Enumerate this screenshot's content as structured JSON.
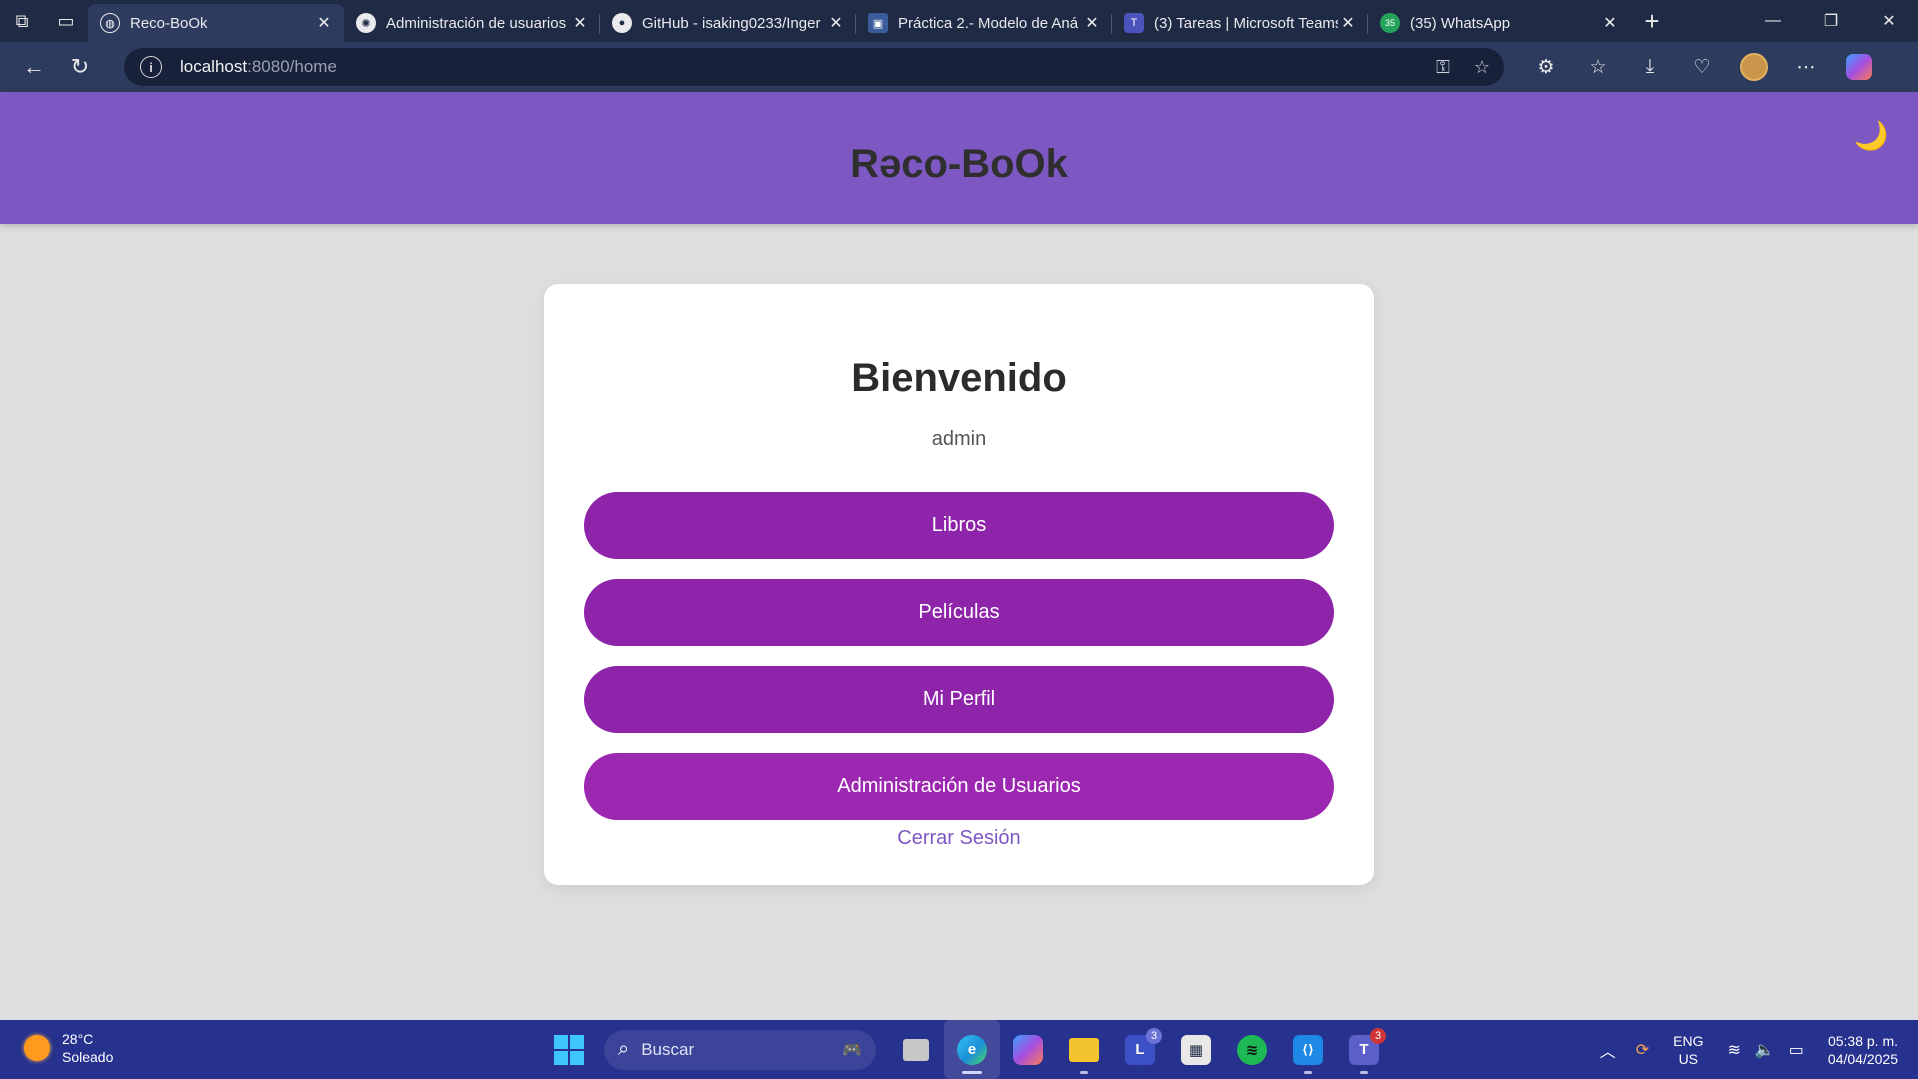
{
  "browser": {
    "tabs": [
      {
        "title": "Reco-BoOk",
        "icon": "globe-icon",
        "active": true,
        "favicon_color": "#2d3b5e",
        "glyph": "◍"
      },
      {
        "title": "Administración de usuarios",
        "icon": "openai-icon",
        "active": false,
        "favicon_color": "#1f2a44",
        "glyph": "✺"
      },
      {
        "title": "GitHub - isaking0233/Inger",
        "icon": "github-icon",
        "active": false,
        "favicon_color": "#1f2a44",
        "glyph": "●"
      },
      {
        "title": "Práctica 2.- Modelo de Aná",
        "icon": "document-icon",
        "active": false,
        "favicon_color": "#3b5b9a",
        "glyph": "▣"
      },
      {
        "title": "(3) Tareas | Microsoft Teams",
        "icon": "teams-icon",
        "active": false,
        "favicon_color": "#4b53bc",
        "glyph": "T"
      },
      {
        "title": "(35) WhatsApp",
        "icon": "whatsapp-icon",
        "active": false,
        "favicon_color": "#25a35a",
        "glyph": "35"
      }
    ],
    "address": {
      "host": "localhost",
      "path": ":8080/home"
    }
  },
  "site": {
    "brand": "Rəco-BoOk",
    "header_color": "#7e58c2",
    "theme_icon": "moon-icon",
    "theme_glyph": "🌙"
  },
  "home": {
    "welcome": "Bienvenido",
    "username": "admin",
    "buttons": [
      {
        "label": "Libros"
      },
      {
        "label": "Películas"
      },
      {
        "label": "Mi Perfil"
      },
      {
        "label": "Administración de Usuarios"
      }
    ],
    "logout": "Cerrar Sesión",
    "button_color": "#8e24aa"
  },
  "taskbar": {
    "weather": {
      "temp": "28°C",
      "condition": "Soleado"
    },
    "search_placeholder": "Buscar",
    "apps": [
      {
        "name": "task-view",
        "label": "▪",
        "color": "#c8c8c8"
      },
      {
        "name": "edge",
        "label": "e",
        "color": "#1a8fd6"
      },
      {
        "name": "copilot",
        "label": "◆",
        "color": "#7b5cd6"
      },
      {
        "name": "file-explorer",
        "label": "▬",
        "color": "#f4c430"
      },
      {
        "name": "lectures",
        "label": "L",
        "color": "#3d4fc4",
        "badge": "3"
      },
      {
        "name": "microsoft-store",
        "label": "▦",
        "color": "#e8e8e8"
      },
      {
        "name": "spotify",
        "label": "≋",
        "color": "#1db954"
      },
      {
        "name": "vscode",
        "label": "⟨⟩",
        "color": "#1e88e5"
      },
      {
        "name": "teams",
        "label": "T",
        "color": "#5b5fc7",
        "badge": "3"
      }
    ],
    "lang": {
      "line1": "ENG",
      "line2": "US"
    },
    "clock": {
      "time": "05:38 p. m.",
      "date": "04/04/2025"
    }
  }
}
